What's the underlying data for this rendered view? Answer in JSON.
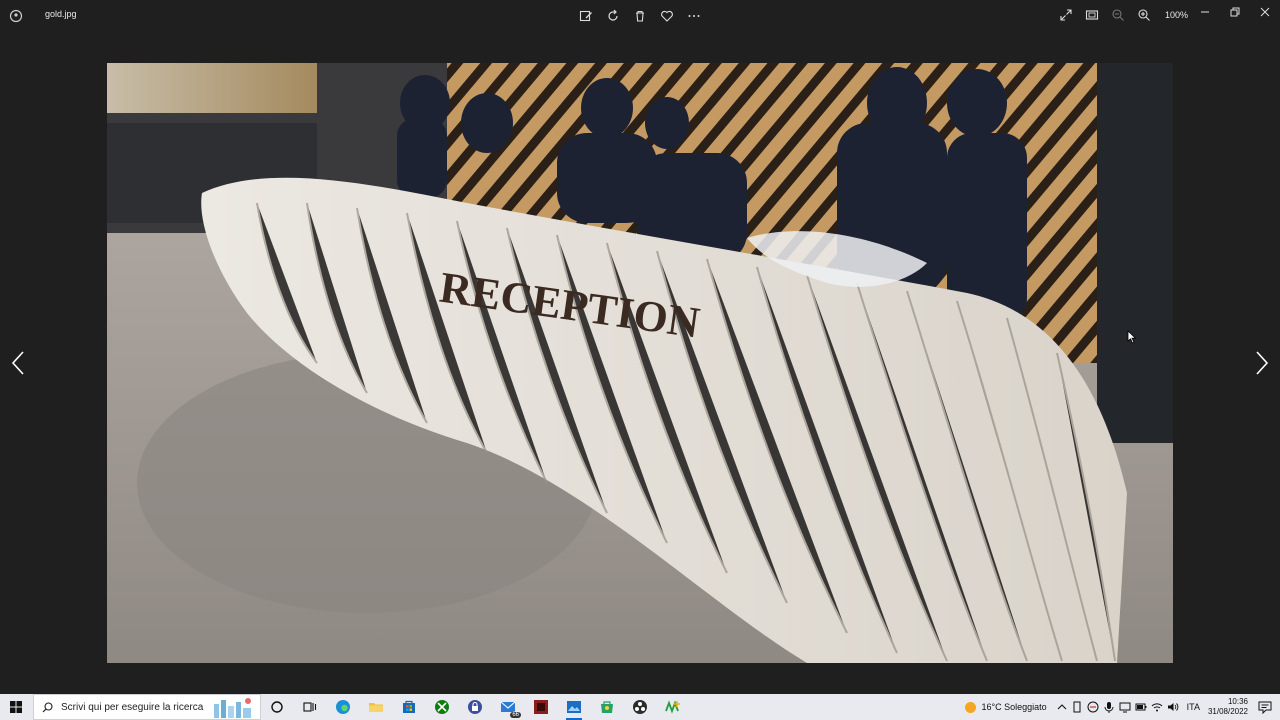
{
  "window": {
    "filename": "gold.jpg",
    "zoom": "100%"
  },
  "photo": {
    "sign_text": "RECEPTION"
  },
  "taskbar": {
    "search_placeholder": "Scrivi qui per eseguire la ricerca",
    "mail_badge": "66",
    "weather": "16°C  Soleggiato",
    "language": "ITA",
    "time": "10:36",
    "date": "31/08/2022"
  },
  "colors": {
    "window_bg": "#1f1f1f",
    "taskbar_bg": "#e9e9f0",
    "accent": "#0a6ed1"
  }
}
